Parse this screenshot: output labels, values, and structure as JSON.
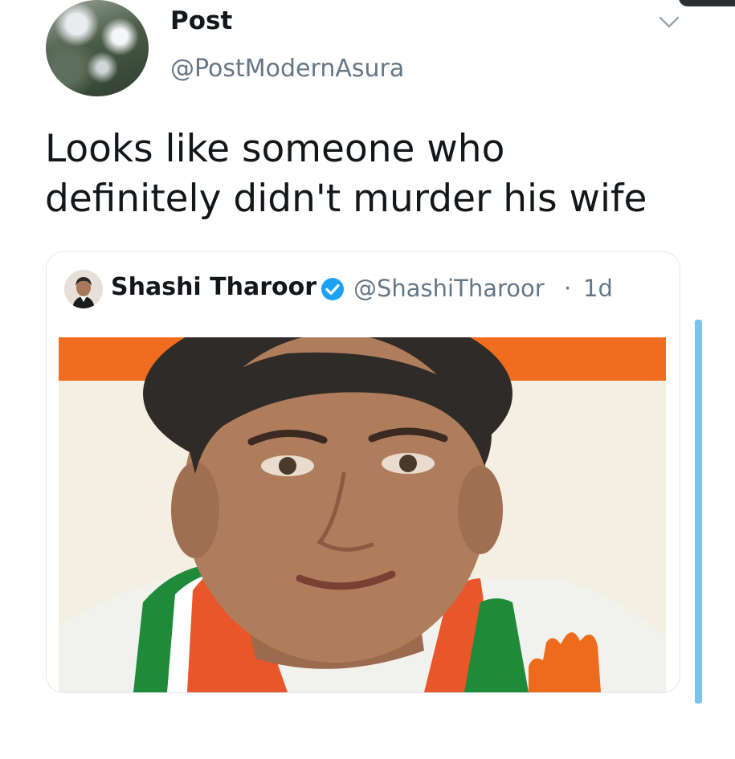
{
  "tweet": {
    "author": {
      "name": "Post",
      "handle": "@PostModernAsura",
      "avatar_icon": "profile-avatar-trees"
    },
    "menu_icon": "chevron-down-icon",
    "text": "Looks like someone who\ndefinitely didn't murder his wife",
    "quote": {
      "author_name": "Shashi Tharoor",
      "verified_icon": "verified-badge-icon",
      "handle": "@ShashiTharoor",
      "separator": "·",
      "time": "1d",
      "image_desc": "portrait-photo"
    }
  },
  "colors": {
    "text_primary": "#14171a",
    "text_secondary": "#657786",
    "verified_blue": "#1da1f2",
    "banner_orange": "#f06c1e",
    "scrollbar": "#7cc3ee"
  }
}
